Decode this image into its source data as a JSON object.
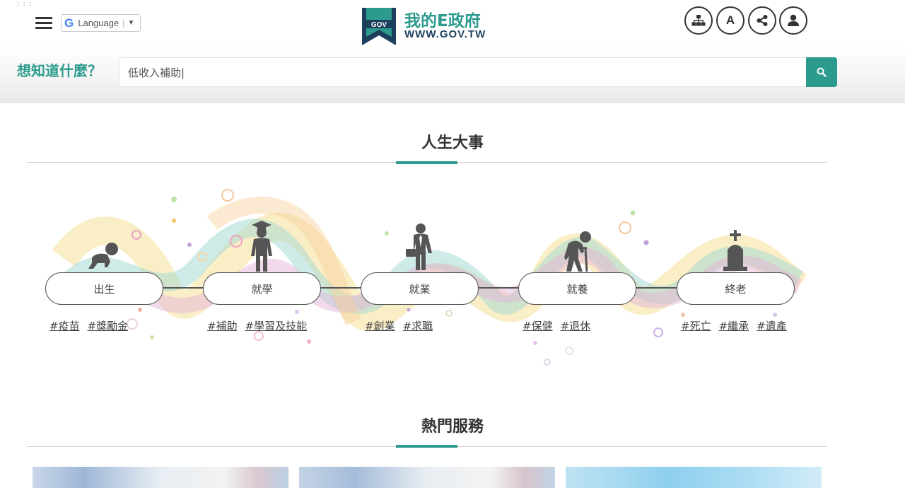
{
  "header": {
    "language_label": "Language",
    "logo_title": "我的E政府",
    "logo_url": "WWW.GOV.TW",
    "logo_badge": "GOV",
    "font_button_label": "A",
    "icons": [
      "menu-icon",
      "sitemap-icon",
      "font-size-icon",
      "share-icon",
      "user-icon",
      "search-icon"
    ]
  },
  "search": {
    "prompt": "想知道什麼？",
    "value": "低收入補助|"
  },
  "life_events": {
    "title": "人生大事",
    "stages": [
      {
        "label": "出生",
        "icon": "baby-icon",
        "tags": [
          "#疫苗",
          "#獎勵金"
        ]
      },
      {
        "label": "就學",
        "icon": "graduate-icon",
        "tags": [
          "#補助",
          "#學習及技能"
        ]
      },
      {
        "label": "就業",
        "icon": "businessman-icon",
        "tags": [
          "#創業",
          "#求職"
        ]
      },
      {
        "label": "就養",
        "icon": "elderly-icon",
        "tags": [
          "#保健",
          "#退休"
        ]
      },
      {
        "label": "終老",
        "icon": "tombstone-icon",
        "tags": [
          "#死亡",
          "#繼承",
          "#遺產"
        ]
      }
    ]
  },
  "popular": {
    "title": "熱門服務"
  },
  "colors": {
    "accent": "#2c9b8e",
    "logo_navy": "#1d3f5e"
  }
}
